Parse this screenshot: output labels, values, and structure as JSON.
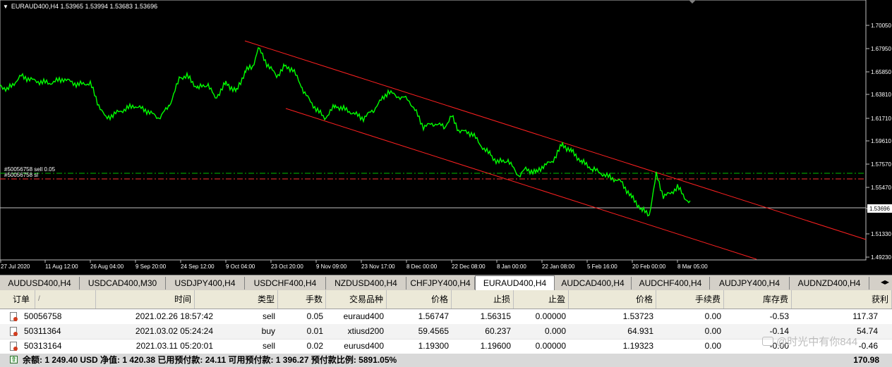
{
  "chart": {
    "title": "EURAUD400,H4  1.53965 1.53994 1.53683 1.53696",
    "price_labels": [
      "1.70050",
      "1.67950",
      "1.65850",
      "1.63810",
      "1.61710",
      "1.59610",
      "1.57570",
      "1.55470",
      "1.53696",
      "1.51330",
      "1.49230"
    ],
    "time_labels": [
      "27 Jul 2020",
      "11 Aug 12:00",
      "26 Aug 04:00",
      "9 Sep 20:00",
      "24 Sep 12:00",
      "9 Oct 04:00",
      "23 Oct 20:00",
      "9 Nov 09:00",
      "23 Nov 17:00",
      "8 Dec 00:00",
      "22 Dec 08:00",
      "8 Jan 00:00",
      "22 Jan 08:00",
      "5 Feb 16:00",
      "20 Feb 00:00",
      "8 Mar 05:00"
    ],
    "order_label_1": "#50056758 sell 0.05",
    "order_label_2": "#50056758 sl",
    "colors": {
      "price": "#00ff00",
      "channel": "#ff2020",
      "bid": "#c0c0c0"
    }
  },
  "tabs": [
    "AUDUSD400,H4",
    "USDCAD400,M30",
    "USDJPY400,H4",
    "USDCHF400,H4",
    "NZDUSD400,H4",
    "CHFJPY400,H4",
    "EURAUD400,H4",
    "AUDCAD400,H4",
    "AUDCHF400,H4",
    "AUDJPY400,H4",
    "AUDNZD400,H4"
  ],
  "active_tab": "EURAUD400,H4",
  "table": {
    "headers": [
      "订单",
      "/",
      "时间",
      "类型",
      "手数",
      "交易品种",
      "价格",
      "止损",
      "止盈",
      "价格",
      "手续费",
      "库存费",
      "获利"
    ],
    "rows": [
      [
        "50056758",
        "2021.02.26 18:57:42",
        "sell",
        "0.05",
        "euraud400",
        "1.56747",
        "1.56315",
        "0.00000",
        "1.53723",
        "0.00",
        "-0.53",
        "117.37"
      ],
      [
        "50311364",
        "2021.03.02 05:24:24",
        "buy",
        "0.01",
        "xtiusd200",
        "59.4565",
        "60.237",
        "0.000",
        "64.931",
        "0.00",
        "-0.14",
        "54.74"
      ],
      [
        "50313164",
        "2021.03.11 05:20:01",
        "sell",
        "0.02",
        "eurusd400",
        "1.19300",
        "1.19600",
        "0.00000",
        "1.19323",
        "0.00",
        "-0.00",
        "-0.46"
      ]
    ]
  },
  "summary": {
    "text": "余额: 1 249.40 USD  净值: 1 420.38  已用预付款: 24.11  可用预付款: 1 396.27  预付款比例: 5891.05%",
    "total": "170.98"
  },
  "watermark": "@时光中有你844"
}
